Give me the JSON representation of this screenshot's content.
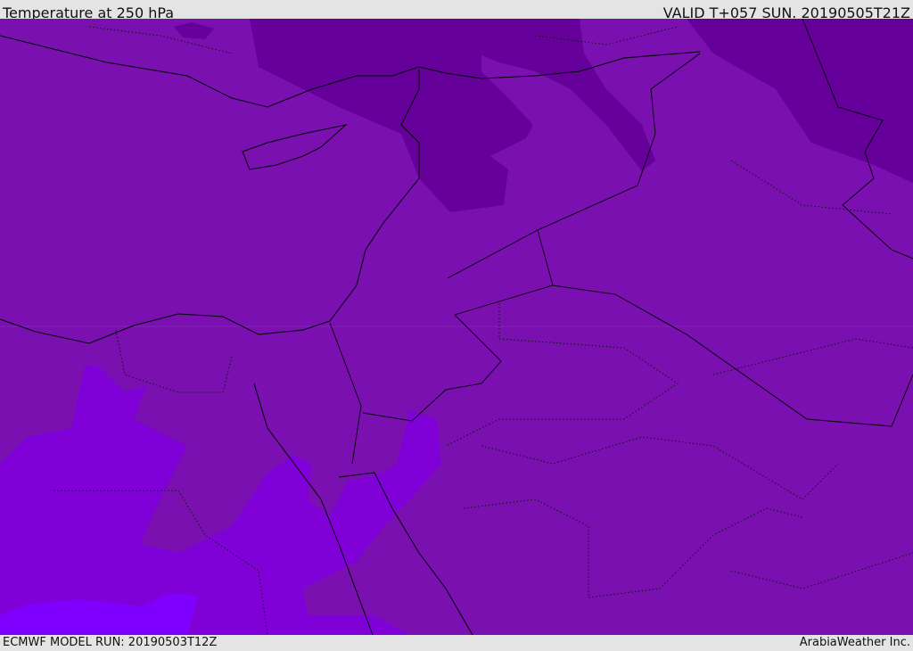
{
  "header": {
    "title": "Temperature at 250 hPa",
    "valid": "VALID T+057 SUN. 20190505T21Z"
  },
  "footer": {
    "model_run": "ECMWF MODEL RUN: 20190503T12Z",
    "credit": "ArabiaWeather Inc."
  },
  "colors": {
    "base": "#7a10b0",
    "cold": "#66009a",
    "warm": "#8000d8",
    "warmest": "#7f00ff"
  }
}
